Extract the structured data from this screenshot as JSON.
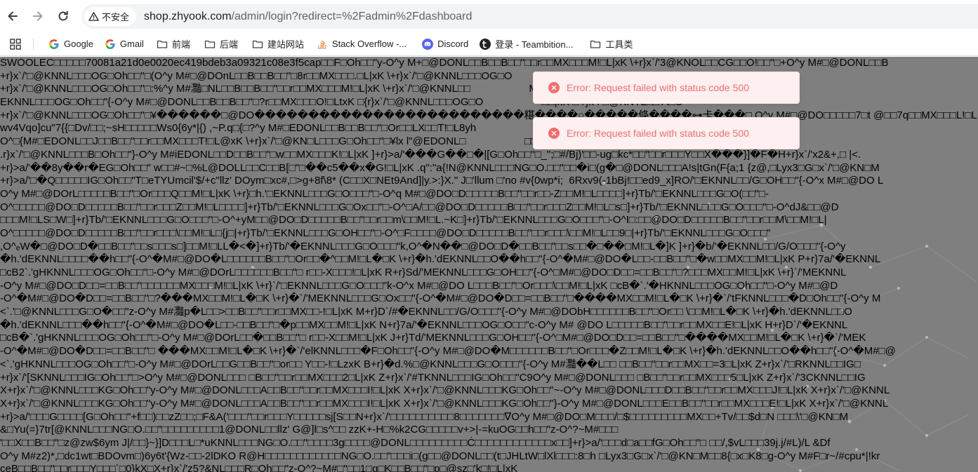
{
  "browser": {
    "security_chip": "不安全",
    "url_host": "shop.zhyook.com",
    "url_path": "/admin/login?redirect=%2Fadmin%2Fdashboard"
  },
  "bookmarks": [
    {
      "label": "Google",
      "icon": "google-icon"
    },
    {
      "label": "Gmail",
      "icon": "google-icon"
    },
    {
      "label": "前端",
      "icon": "folder-icon"
    },
    {
      "label": "后端",
      "icon": "folder-icon"
    },
    {
      "label": "建站网站",
      "icon": "folder-icon"
    },
    {
      "label": "Stack Overflow -...",
      "icon": "stackoverflow-icon"
    },
    {
      "label": "Discord",
      "icon": "discord-icon"
    },
    {
      "label": "登录 - Teambition...",
      "icon": "teambition-icon"
    },
    {
      "label": "工具类",
      "icon": "folder-icon"
    }
  ],
  "toasts": [
    {
      "message": "Error: Request failed with status code 500"
    },
    {
      "message": "Error: Request failed with status code 500"
    }
  ],
  "garbled_lines": [
    "SWOOLEC□□□□□70081a21d0e0020ec419bdeb3a09321c08e3f5cap□□F□Oh□□\"y-O^y M+□@DONL□□B□□B□□\"□□r□□MX□□□M!□L|xK \\+r}x`/'3@KNOL□□CG□□O!□□\"□+O^y M#□@DONL□□B",
    "+r}x`/'□@KNNL□□□OG□Oh□□\"□(O^y M#□@DOnL□□B□□B□□\"□8r□□MX□□□.□L|xK \\+r}x`/'□@KNNL□□□OG□O                    ZX□□U!□L□□□□T(r}x`/'□@KOL",
    "+r}x`/'□@KNNL□□□OG□Oh□□\"□:%^y M#灩□NL□□B□□B□□\"□□r□□MX□□□M!□L|xK \\+r}x`/'□@KNNL□□                    MX□□□M!□L|xK \\+r}x`/'□@KN□M",
    "EKNNL□□□OG□Oh□□\"{-O^y M#□@DONL□□B□□B□□\"□?r□□MX□□□O!□LtxK □{r}x`/'□@KNNL□□□OG□O                    □□|xK □ r}x`/'□@KNTL□□ A□O",
    "+r}x`/'□@KNNL□□□OG□Oh□□\"□¥������□@DO�������������������������糂����○�����倏����⊶卡���□.O^y M#□@DO□□□□□7□t @□□7q□□MX□□□L!□L:yK",
    "wv4Vqo]cu\"7{{□Dv/□□;~sH□□□□□Ws0{6y*|{) ,~P.q□{□?^y M#□EDONL□□B□□B□□\"□Or□□LX□□T!□L8yh                    □□□B□□B□□\"□ r□□MX□□T!□L@x",
    "O^□{M#□EDONL□□J□□B□□\"□□r□□MX□□□T!□L@xK \\+r}x`/'□@KN□L□□□G□Oh□□\"□¥lx l\"@EDONL□                    □□OG□Oh□□\"�¥�� I#□DDONL",
    ".r}x`/'□@KNNL□□□B□Oh□□\"}-O^y M#iEDONL□□D□□B□□\"□w□□MX□□□K!□L|xK ]+r}>a/'���G��□�|[G□Oh□□\"□_\";□#/Bj)'□□-ug□kc*□□\"□□r□□□Y□□X���}]�F�H+r}x`/'x2&+,□ |<.",
    "+r}>a/'��8y��r�EG□Oh□□\" w□□#~□%L@DOLL□□C□□B[□\"□��c5��x�G!□L|xK .q\":\"a{!N@KNNL□□□NG□O.□□\"□□�i□(g�□@DONL□□□A!s|tGn(F{a;1 {z@,□Lyx3□G□x`/'□@KN□M",
    "+r}>a/'□�Q□□□□□IG□Oh□□\"T□eTYUmcil'$/+c\"llz' DOym□xc#,□>g+8f\\8* (C□□X□NEt9And]|y.>:}X.\" J□'llum □'no #v{0wp*i;  6Rxv9(-1bBj!□□ed9_x]RO/'□EKNNL□□/G□OH□□\"{-O^x M#□@DO L",
    "O^y M#□@DOrL□□□□□B□□\"□Or□□□Q□□M!□L|xK \\+r}□h.'□EKNNL□□□G□O□□□\"□-O^q M#□@DO□D□□□□□B□□\"□□r□□-Z□□M!□L□□□□]+r}Tb/'□EKNNL□□□G□O(□□\"□-",
    "O^□□□□□@DO□D□□□□□B□□\"□□r□□□Z□□M!□L□□□□]+r}Tb/'□EKNNL□□□G□Ox□□\"□-O^□A/□□@DO□D□□□□□B□□\"□□r□□□Z□□M!□L□s□]+r}Tb/'□EKNNL□□□G□O□□□\"□-O^dJ&□□@D",
    "□□□M!□LS□W□]+r}Tb/'□EKNNL□□□G□O□□□\"□-O^+yM□□@DO□D□□□□□B□□\"□□r□□m\\□□M!□L.~K□]+r}Tb/'□EKNNL□□□G□O□□□\"□-O^I□:□□@DO□D□□□□□B□□\"□□r□□M\\□□M!□L|",
    "O^□□□□□@DO□D□□□□□B□□\"□□r□□□\\□□M!□L□{j□|+r}Tb/'□EKNNL□□□G□OH□□\"□-O^□F□□□□@DO□D□□□□□B□□\"□□r□□□\\□□M!□L□□9□|+r}Tb/'□EKNNL□□□G□O□□□\"",
    ",O^ₑW�□@DO□D�□□B□□\"□□s□□□s□]□□M!□LL�<�]+r}Tb/'�EKNNL□□□G□O□□□\"k,O^�N��□@DO□D�□□B□□\"□□s□□�□��□M!□L�]K ]+r}�b/'�EKNNL□□/G/O□□□\"{-O^y",
    "�h.'dEKNNL□□□□��h□□\"{-O^�M#□@DO�L□□□□□□B□□\"□Or□□�^□□M!□L�□K \\+r}�h.'dEKNNL□□O��h□□\"{-O^�M#□@DO�L□□-□□B□□\"□�w□□MX□□M!□L|xK P+r}7a/'�EKNNL",
    "□cB2`.'gHKNNL□□□OG□Oh□□\"□-O^y M#□@DOrL□□□□□□B□□\"□ r□□-X□□□!□L|xK R+r}Sd/'MEKNNL□□□G□OH□□\"{-O^□M#□@DO□D□□=□□B□□\"□?□□□MX□□M!□L|xK \\+r}`/'MEKNNL",
    "-O^y M#□@DO□D□□=□□B□□\"□□□□□□MX□□□M!□L|xK \\+r}`/'□EKNNL□□□G□O□□□\"k-O^x M#□@DO L□□□B□□\"□Or□□□\\□□M!□L|xK □cB�`.'�HKNNL□□□OG□Oh□□\"□-O^y M#□@D",
    "-O^�M#□@DO�D□□=□□B□□\"□?���MX□□M!□L�□K \\+r}�`/'MEKNNL□□□G□Ox□□\"{-O^�M#□@DO�D□□=□□B□□\"□����MX□□M!□L�□K \\+r}�`/'tFKNNL□□□�D□Oh□□\"{-O^y M",
    "<`.'□@KNNL□□□G□O�□□\"z-O^y M#灩p�L□□>□□B□□\"□□r□□MX□□-!□L|xK M+r}D`/#�EKNNL□□/G/O□□□\"{-O^y M#□@DObH□□□□□□B□□\"□Or□□ \\□□M!□L�□K \\+r}�h.'dEKNNL□□O",
    "�h.'dEKNNL□□□��h□□\"{-O^�M#□@DO�L□□-□□B□□\"□�p□□MX□□M!□L|xK N+r}7a/'�EKNNL□□□OG□O□□\"c-O^y M# @DO L□□□□□B□□\"□□r□□MX□□E!□L|xK H+r}D`/'�EKNNL",
    "□cB�`.'gHKNNL□□□OG□Oh□□\"□-O^y M#□@DOrL□□�□□B□□\"□ r□□-X□□M!□L|xK J+r}Td/'MEKNNL□□□G□OH□□\"{-O^□M#□@DO□D□□=□□B□□\"□����MX□□M!□L�□K \\+r}�`/'MEK",
    "-O^�M#□@DO�D□□=□□B□□\"□ ���MX□□M!□L�□K \\+r}�`/'elKNNL□□□�F□Oh□□\"{-O^y M#□@DO�M□□□□□□B□□\"□Or□□□�Z□□M!□L�□K \\+r}�h.'dEKNNL□□O��h□□\"{-O^�M#□@",
    "<`.'gHKNNL□□□OG□Oh□□\"□-O^y M#□@DOrL□□G□□B□□\"□or□□ Y□□-!□LzxK B+r}�d.%□@KNNL□□□G□O□□□\"{-O^y M#灩��L□□ □□B□□\"□□r□□MX□□=3□L|xK Z+r}x`/'□RKNNL□□IG□",
    "+r}x`/'[SKNNL□□□IG□Oh□□\"□>O^y M#□@DONL□□□ □B□□\"□□r□□MX□□□2□L|xK Z+r}x`/'#TKNNL□□□IG□Oh□□\"C9O^y M#□@DONL□□□ □B□□\"□□r□□MX□□□5□L|xK Z+r}x`/'3CKNNL□□IG",
    "X+r}x`/'□@KNNL□□□KG□Oh□□\"y-O^y M#□@DONL□□□A□□B□□\"□□r□□MX□□□I!□L|xK X+r}x`/'□@KNNL□□□KG□Oh□□\"~-O^y M#□@DONL□□□D□□B□□\"□□r□□MX□□□J!□L|xK X+r}x`/'□@KNNL",
    "X+r}x`/'□@KNNL□□□KG□Oh□□\"y-O^y M#□@DONL□□□A□□B□□\"□□r□□MX□□□I!□L|xK X+r}x`/'□@KNNL□□□KG□Oh□□\"}-O^y M#□@DONL□□□E□□B□□\"□□r□□MX□□□E!□L|xK X+r}x`/'□@KNNL",
    "+r}>a/'□□□G□□□□[G□Oh□□\"+f□□)□□zZ□□;□F&A('□□□\"□□r□□□Y□□□□□sj[S□□N+r}x`/'□□□□□□□□□□8□□□□□□□∇O^y M#□@DO□M□□□/□$□□□□□□□□□MX□□+Tv/□□$d□N □□□\\'□@KN□M",
    "&□Yu(=}7tr[@KNNL□□□NG□O.□□\"□□□□□□□□□1@DONL□□llz' G@]l□s^□□ zzK+-H□%k2CG□□□□□v+>|-=kuOG□□h□□\"z-O^?~M#□□□",
    "'□□X□□B□□\"□z@zw$6ym J|/□□}~}]D□□□L□*uKNNL□□□NG□O.□□\"□□□□3g□□□□@DONL□□□□□□□□□Ċ□□□□□□□□□□□□x□□]+r}>a/'□□□d□a□□fG□Oh□□\"□ □□/,$vL□□□39j.j/#L)/L &Df",
    "O^y M#z2)*,□dc1wt□BDOvm□)6y6t'{Wz-□□-2lDKO R@H□□□□□□□□□□□□NG□O.□□\"□□□i□(g□□@DONL□□(t□JHLtW□lXl□□□:8□h □Lyx3□G□x`/'□@KN□M□□8{□x□K8□g-O^y M#F□r~/#cpu*|!kr",
    "ceB□□B□□\"□□r□□□Y□□□`□0}kX□X+r}x`/'z5?&NL□□□R□Oh□□\"z-O^?~M#□\"□□1□q□K□□B□□\"□p□@sz□'k□!□L|xK"
  ]
}
